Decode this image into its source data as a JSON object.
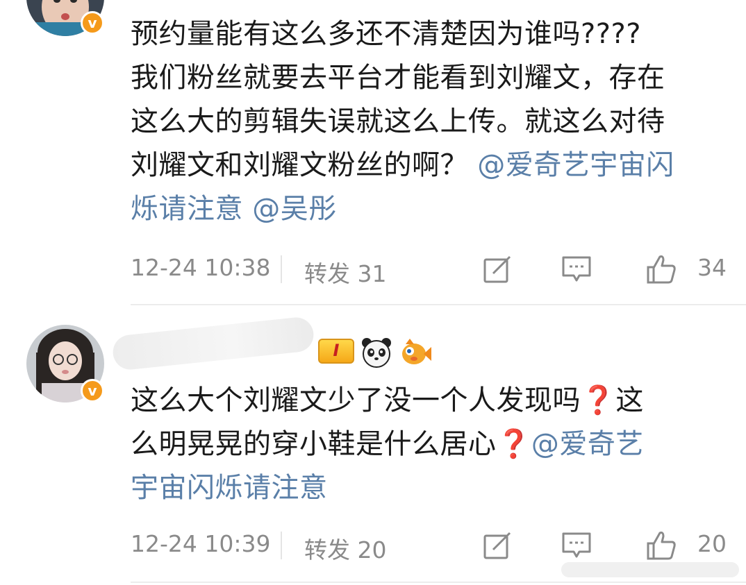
{
  "posts": [
    {
      "text_lines": [
        "预约量能有这么多还不清楚因为谁吗????",
        "我们粉丝就要去平台才能看到刘耀文，存在",
        "这么大的剪辑失误就这么上传。就这么对待"
      ],
      "line4_text": "刘耀文和刘耀文粉丝的啊？",
      "line4_mention": "@爱奇艺宇宙闪",
      "line5_mention_a": "烁请注意",
      "line5_mention_b": "@吴彤",
      "time": "12-24 10:38",
      "repost_label": "转发 31",
      "likes": "34"
    },
    {
      "line1_text": "这么大个刘耀文少了没一个人发现吗",
      "line1_q": "❓",
      "line1_tail": "这",
      "line2_text": "么明晃晃的穿小鞋是什么居心",
      "line2_q": "❓",
      "line2_mention": "@爱奇艺",
      "line3_mention": "宇宙闪烁请注意",
      "level_badge": "I",
      "time": "12-24 10:39",
      "repost_label": "转发 20",
      "likes": "20"
    }
  ],
  "icons": [
    "verified-v-icon",
    "edit-icon",
    "comment-icon",
    "like-icon",
    "panda-emoji-icon",
    "fish-emoji-icon"
  ],
  "colors": {
    "mention": "#5a7fa8",
    "meta": "#8a8a8a",
    "verified": "#f59a1b",
    "question_mark": "#e0262b"
  }
}
